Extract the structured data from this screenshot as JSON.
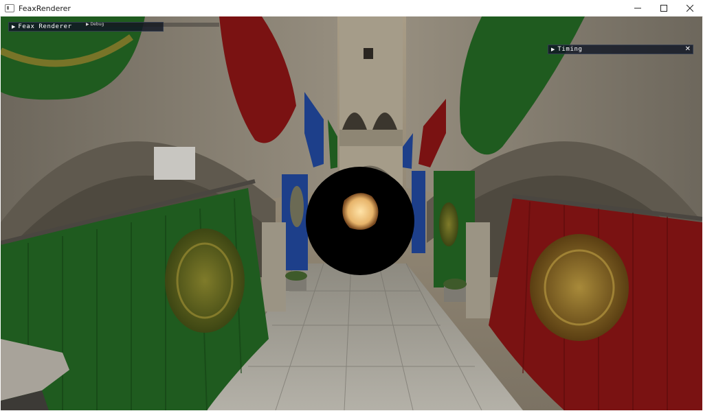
{
  "window": {
    "title": "FeaxRenderer",
    "minimize_glyph": "—",
    "maximize_glyph": "☐",
    "close_glyph": "✕"
  },
  "overlays": {
    "main_panel": {
      "title": "Feax Renderer",
      "collapsed_glyph": "▶"
    },
    "debug_section": {
      "title": "Debug",
      "collapsed_glyph": "▶"
    },
    "timing_panel": {
      "title": "Timing",
      "collapsed_glyph": "▶",
      "close_glyph": "✕"
    }
  },
  "colors": {
    "green_banner": "#1f5b1f",
    "red_banner": "#7a1212",
    "blue_banner": "#1d3f8a",
    "stone": "#8b8476",
    "sphere": "#000000",
    "glow": "#f4c26e"
  },
  "icons": {
    "app": "window-app-icon",
    "minimize": "minimize-icon",
    "maximize": "maximize-icon",
    "close": "close-icon"
  }
}
